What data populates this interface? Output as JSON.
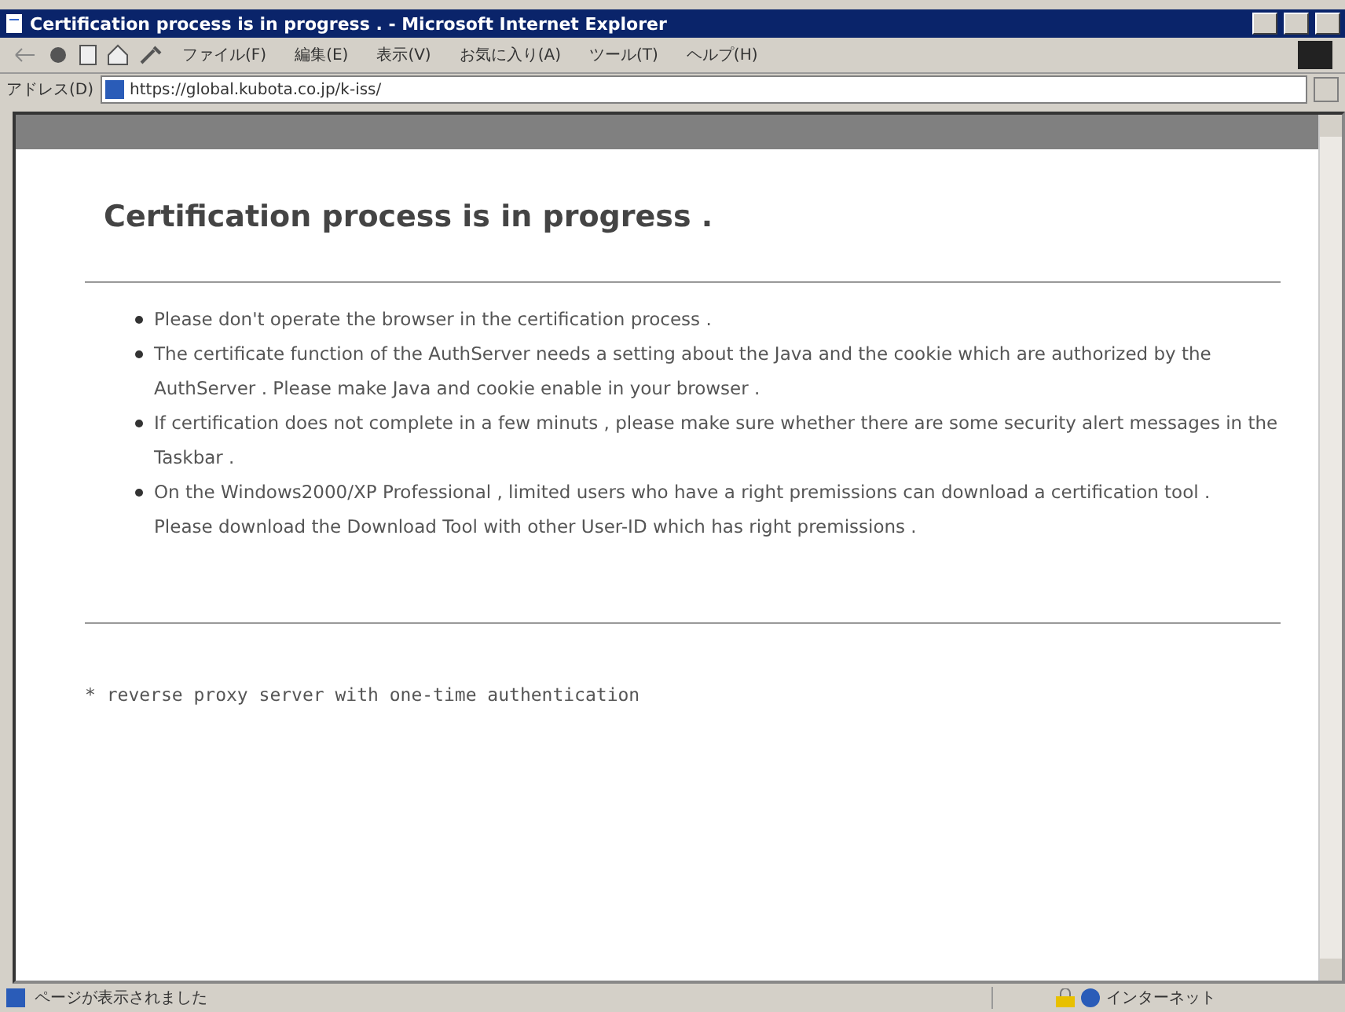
{
  "window": {
    "title": "Certification process is in progress . - Microsoft Internet Explorer"
  },
  "menu": [
    "ファイル(F)",
    "編集(E)",
    "表示(V)",
    "お気に入り(A)",
    "ツール(T)",
    "ヘルプ(H)"
  ],
  "address": {
    "label": "アドレス(D)",
    "value": "https://global.kubota.co.jp/k-iss/"
  },
  "page": {
    "heading": "Certification process is in progress .",
    "bullets": [
      {
        "lines": [
          "Please don't operate the browser in the certification process ."
        ]
      },
      {
        "lines": [
          "The certificate function of the AuthServer needs a setting about the Java and the cookie which are authorized by the AuthServer . Please make Java and cookie enable in your browser ."
        ]
      },
      {
        "lines": [
          "If certification does not complete in a few minuts , please make sure whether there are some security alert messages in the Taskbar ."
        ]
      },
      {
        "lines": [
          "On the Windows2000/XP Professional , limited users who have a right premissions can download a certification tool .",
          "Please download the Download Tool with other User-ID which has right premissions ."
        ]
      }
    ],
    "footer_note": "* reverse proxy server with one-time authentication"
  },
  "status_bar": {
    "message": "ページが表示されました",
    "zone": "インターネット"
  }
}
